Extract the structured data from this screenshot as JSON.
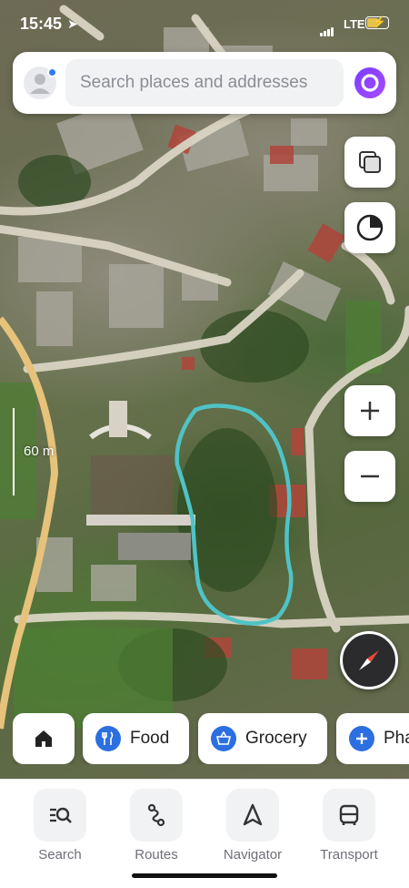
{
  "status_bar": {
    "time": "15:45",
    "network": "LTE"
  },
  "search": {
    "placeholder": "Search places and addresses"
  },
  "map": {
    "scale_label": "60 m",
    "highlight_color": "#4fc3c6"
  },
  "chips": [
    {
      "label": "",
      "icon": "home-icon"
    },
    {
      "label": "Food",
      "icon": "fork-knife-icon"
    },
    {
      "label": "Grocery",
      "icon": "basket-icon"
    },
    {
      "label": "Pha",
      "icon": "plus-icon"
    }
  ],
  "bottom_nav": [
    {
      "label": "Search",
      "icon": "search-list-icon"
    },
    {
      "label": "Routes",
      "icon": "route-icon"
    },
    {
      "label": "Navigator",
      "icon": "navigation-arrow-icon"
    },
    {
      "label": "Transport",
      "icon": "bus-icon"
    }
  ]
}
